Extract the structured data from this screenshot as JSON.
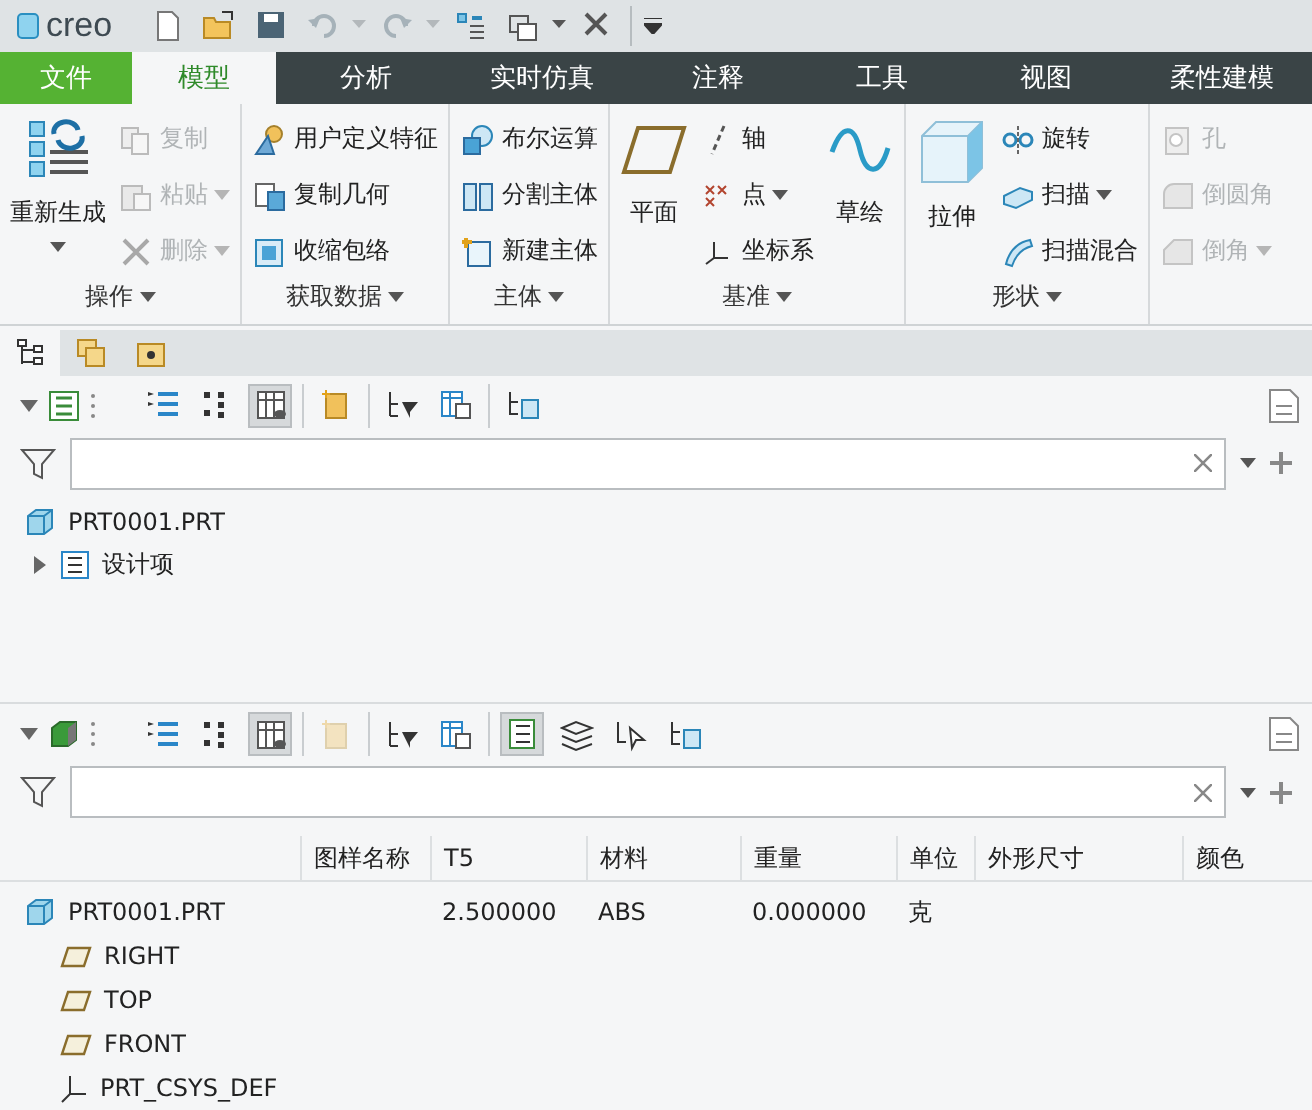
{
  "quick_access": {
    "logo": "creo",
    "tools": [
      {
        "disabled": false
      },
      {
        "disabled": false
      },
      {
        "disabled": false
      },
      {
        "disabled": true
      },
      {
        "disabled": true
      },
      {
        "disabled": false
      },
      {
        "disabled": false
      },
      {
        "disabled": false
      }
    ]
  },
  "ribbon_tabs": [
    {
      "label": "文件",
      "kind": "file",
      "selected": false
    },
    {
      "label": "模型",
      "kind": "tab",
      "selected": true
    },
    {
      "label": "分析",
      "kind": "tab",
      "selected": false
    },
    {
      "label": "实时仿真",
      "kind": "tab",
      "selected": false
    },
    {
      "label": "注释",
      "kind": "tab",
      "selected": false
    },
    {
      "label": "工具",
      "kind": "tab",
      "selected": false
    },
    {
      "label": "视图",
      "kind": "tab",
      "selected": false
    },
    {
      "label": "柔性建模",
      "kind": "tab",
      "selected": false
    }
  ],
  "ribbon_groups": [
    {
      "label": "操作",
      "columns": [
        {
          "kind": "large",
          "items": [
            {
              "label": "重新生成",
              "disabled": false,
              "dropdown": true
            }
          ]
        },
        {
          "kind": "small",
          "items": [
            {
              "label": "复制",
              "disabled": true,
              "dropdown": false
            },
            {
              "label": "粘贴",
              "disabled": true,
              "dropdown": true
            },
            {
              "label": "删除",
              "disabled": true,
              "dropdown": true
            }
          ]
        }
      ]
    },
    {
      "label": "获取数据",
      "columns": [
        {
          "kind": "small",
          "items": [
            {
              "label": "用户定义特征",
              "disabled": false,
              "dropdown": false
            },
            {
              "label": "复制几何",
              "disabled": false,
              "dropdown": false
            },
            {
              "label": "收缩包络",
              "disabled": false,
              "dropdown": false
            }
          ]
        }
      ]
    },
    {
      "label": "主体",
      "columns": [
        {
          "kind": "small",
          "items": [
            {
              "label": "布尔运算",
              "disabled": false,
              "dropdown": false
            },
            {
              "label": "分割主体",
              "disabled": false,
              "dropdown": false
            },
            {
              "label": "新建主体",
              "disabled": false,
              "dropdown": false
            }
          ]
        }
      ]
    },
    {
      "label": "基准",
      "columns": [
        {
          "kind": "large",
          "items": [
            {
              "label": "平面",
              "disabled": false,
              "dropdown": false
            }
          ]
        },
        {
          "kind": "small",
          "items": [
            {
              "label": "轴",
              "disabled": false,
              "dropdown": false
            },
            {
              "label": "点",
              "disabled": false,
              "dropdown": true
            },
            {
              "label": "坐标系",
              "disabled": false,
              "dropdown": false
            }
          ]
        },
        {
          "kind": "large",
          "items": [
            {
              "label": "草绘",
              "disabled": false,
              "dropdown": false
            }
          ]
        }
      ]
    },
    {
      "label": "形状",
      "columns": [
        {
          "kind": "large",
          "items": [
            {
              "label": "拉伸",
              "disabled": false,
              "dropdown": false
            }
          ]
        },
        {
          "kind": "small",
          "items": [
            {
              "label": "旋转",
              "disabled": false,
              "dropdown": false
            },
            {
              "label": "扫描",
              "disabled": false,
              "dropdown": true
            },
            {
              "label": "扫描混合",
              "disabled": false,
              "dropdown": false
            }
          ]
        }
      ]
    },
    {
      "columns": [
        {
          "kind": "small",
          "items": [
            {
              "label": "孔",
              "disabled": true,
              "dropdown": false
            },
            {
              "label": "倒圆角",
              "disabled": true,
              "dropdown": false
            },
            {
              "label": "倒角",
              "disabled": true,
              "dropdown": true
            }
          ]
        }
      ]
    }
  ],
  "navigator_tabs": [
    {
      "selected": true
    },
    {
      "selected": false
    },
    {
      "selected": false
    }
  ],
  "model_tree": {
    "tools": [
      {
        "selected": false,
        "disabled": false
      },
      {
        "selected": false,
        "disabled": false
      },
      {
        "selected": true,
        "disabled": false
      },
      {
        "selected": false,
        "disabled": false
      },
      {
        "selected": false,
        "disabled": false
      },
      {
        "selected": false,
        "disabled": false
      },
      {
        "selected": false,
        "disabled": false
      }
    ],
    "items": [
      {
        "label": "PRT0001.PRT",
        "kind": "part",
        "children": [
          {
            "label": "设计项",
            "kind": "folder",
            "expanded": false
          }
        ]
      }
    ]
  },
  "detail_tree": {
    "tools": [
      {
        "selected": false,
        "disabled": false
      },
      {
        "selected": false,
        "disabled": false
      },
      {
        "selected": true,
        "disabled": false
      },
      {
        "selected": false,
        "disabled": true
      },
      {
        "selected": false,
        "disabled": false
      },
      {
        "selected": false,
        "disabled": false
      },
      {
        "selected": true,
        "disabled": false
      },
      {
        "selected": false,
        "disabled": false
      },
      {
        "selected": false,
        "disabled": false
      },
      {
        "selected": false,
        "disabled": false
      }
    ],
    "columns": [
      "",
      "图样名称",
      "T5",
      "材料",
      "重量",
      "单位",
      "外形尺寸",
      "颜色"
    ],
    "rows": [
      {
        "kind": "part",
        "cells": [
          "PRT0001.PRT",
          "",
          "2.500000",
          "ABS",
          "0.000000",
          "克",
          "",
          ""
        ],
        "children": [
          {
            "kind": "plane",
            "cells": [
              "RIGHT",
              "",
              "",
              "",
              "",
              "",
              "",
              ""
            ]
          },
          {
            "kind": "plane",
            "cells": [
              "TOP",
              "",
              "",
              "",
              "",
              "",
              "",
              ""
            ]
          },
          {
            "kind": "plane",
            "cells": [
              "FRONT",
              "",
              "",
              "",
              "",
              "",
              "",
              ""
            ]
          },
          {
            "kind": "csys",
            "cells": [
              "PRT_CSYS_DEF",
              "",
              "",
              "",
              "",
              "",
              "",
              ""
            ]
          }
        ]
      }
    ]
  }
}
